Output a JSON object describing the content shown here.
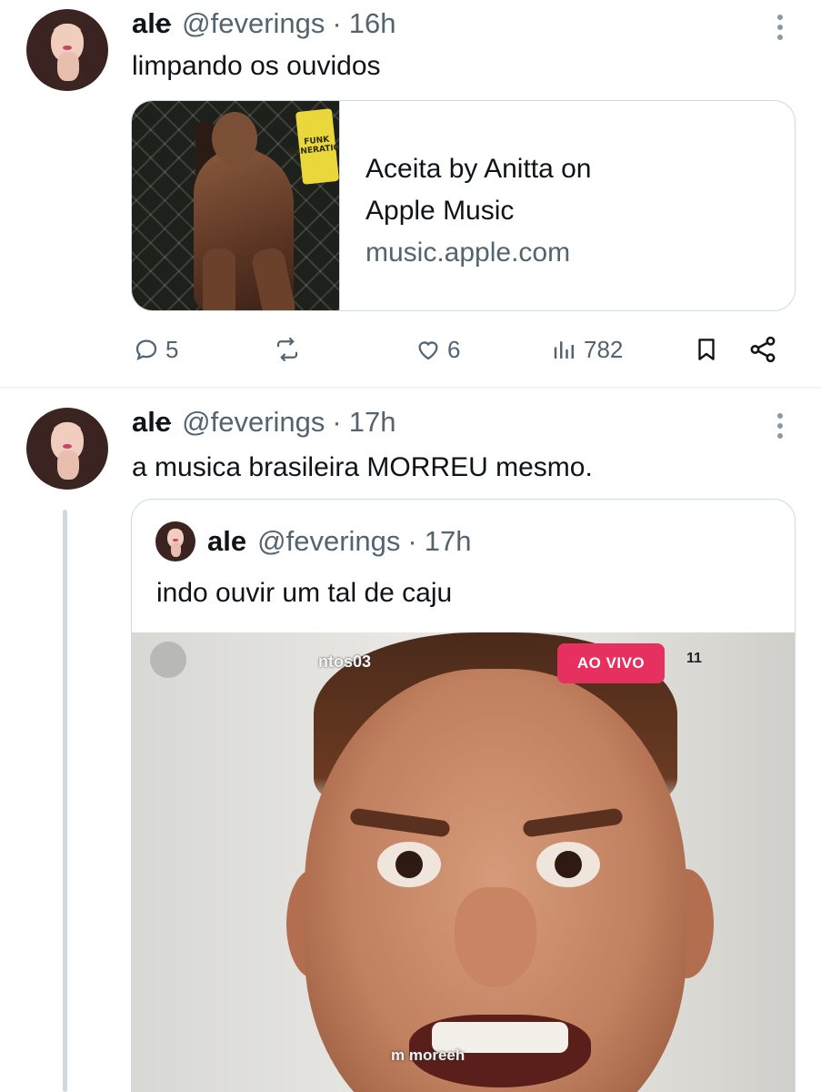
{
  "tweet1": {
    "name": "ale",
    "handle": "@feverings",
    "dot": "·",
    "time": "16h",
    "text": "limpando os ouvidos",
    "card": {
      "sticker": "FUNK GENERATION",
      "title": "Aceita by Anitta on Apple Music",
      "domain": "music.apple.com"
    },
    "actions": {
      "replies": "5",
      "reposts": "",
      "likes": "6",
      "views": "782"
    }
  },
  "tweet2": {
    "name": "ale",
    "handle": "@feverings",
    "dot": "·",
    "time": "17h",
    "text": "a musica brasileira MORREU mesmo.",
    "quote": {
      "name": "ale",
      "handle": "@feverings",
      "dot": "·",
      "time": "17h",
      "text": "indo ouvir um tal de caju",
      "media": {
        "live_badge": "AO VIVO",
        "overlay_name": "ntos03",
        "overlay_viewers": "11",
        "caption": "m moreeh"
      }
    }
  },
  "colors": {
    "text_primary": "#0f1419",
    "text_secondary": "#536471",
    "border": "#cfd9de",
    "live_badge": "#e6305f"
  },
  "icons": [
    "more-icon",
    "reply-icon",
    "repost-icon",
    "like-icon",
    "views-icon",
    "bookmark-icon",
    "share-icon"
  ]
}
